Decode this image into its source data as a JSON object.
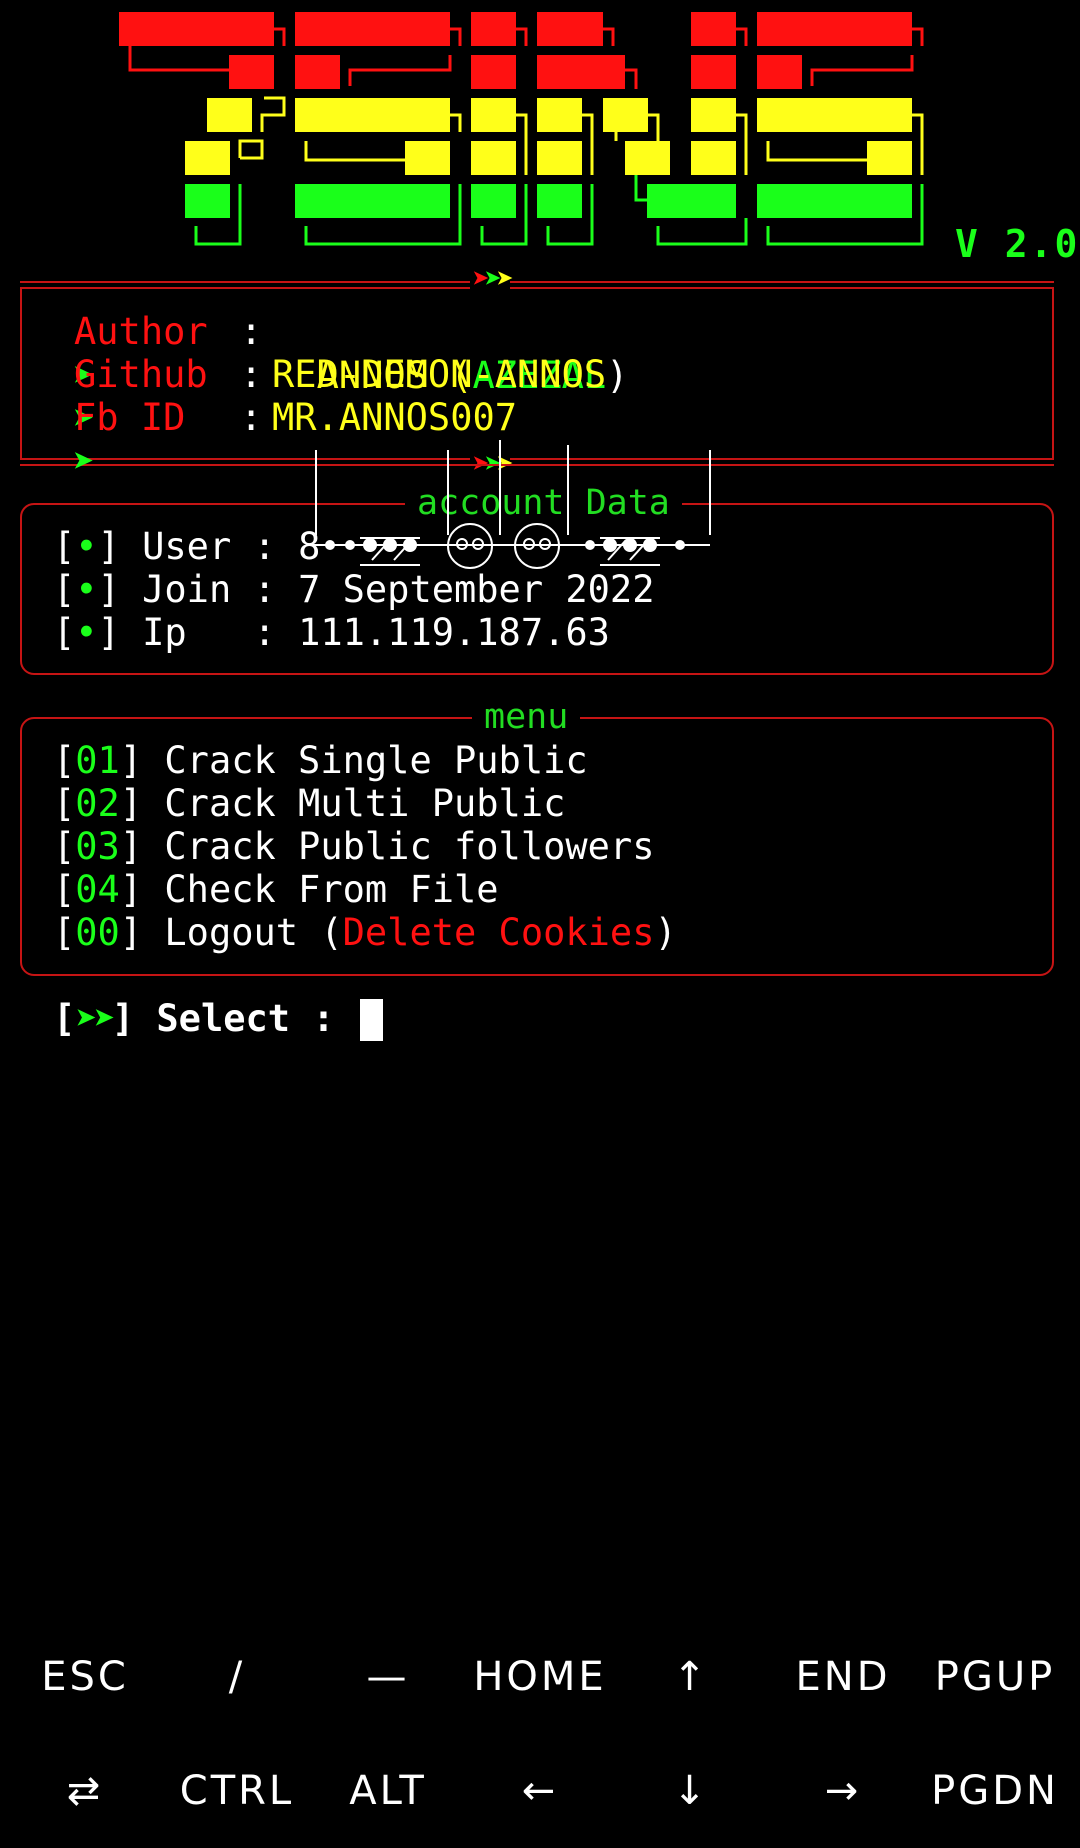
{
  "colors": {
    "red": "#ff1111",
    "yellow": "#ffff1a",
    "green": "#1aff1a",
    "white": "#ffffff",
    "border": "#c61414",
    "menu_green": "#22dd22"
  },
  "header": {
    "version": "V 2.0",
    "logo_text": "TSMS"
  },
  "info": {
    "separator_arrows": [
      "➤",
      "➤",
      "➤"
    ],
    "rows": [
      {
        "bullet": "➤",
        "label": "Author",
        "colon": ":",
        "value_a": "ANNOS",
        "value_b": "AZEZAL"
      },
      {
        "bullet": "➤",
        "label": "Github",
        "colon": ":",
        "value": "RED-DEMON-ANNOS"
      },
      {
        "bullet": "➤",
        "label": "Fb ID",
        "colon": ":",
        "value": "MR.ANNOS007"
      }
    ]
  },
  "account": {
    "title": "account Data",
    "rows": [
      {
        "marker": "•",
        "label": "User",
        "value": "8"
      },
      {
        "marker": "•",
        "label": "Join",
        "value": "7 September 2022"
      },
      {
        "marker": "•",
        "label": "Ip  ",
        "value": "111.119.187.63"
      }
    ]
  },
  "menu": {
    "title": "menu",
    "items": [
      {
        "num": "01",
        "label": "Crack Single Public"
      },
      {
        "num": "02",
        "label": "Crack Multi Public"
      },
      {
        "num": "03",
        "label": "Crack Public followers"
      },
      {
        "num": "04",
        "label": "Check From File"
      },
      {
        "num": "00",
        "label": "Logout (",
        "label_red": "Delete Cookies",
        "label_end": ")"
      }
    ]
  },
  "prompt": {
    "arrows": "➤➤",
    "label": "Select :"
  },
  "keys": {
    "row1": [
      "ESC",
      "/",
      "—",
      "HOME",
      "↑",
      "END",
      "PGUP"
    ],
    "row2": [
      "⇄",
      "CTRL",
      "ALT",
      "←",
      "↓",
      "→",
      "PGDN"
    ]
  }
}
